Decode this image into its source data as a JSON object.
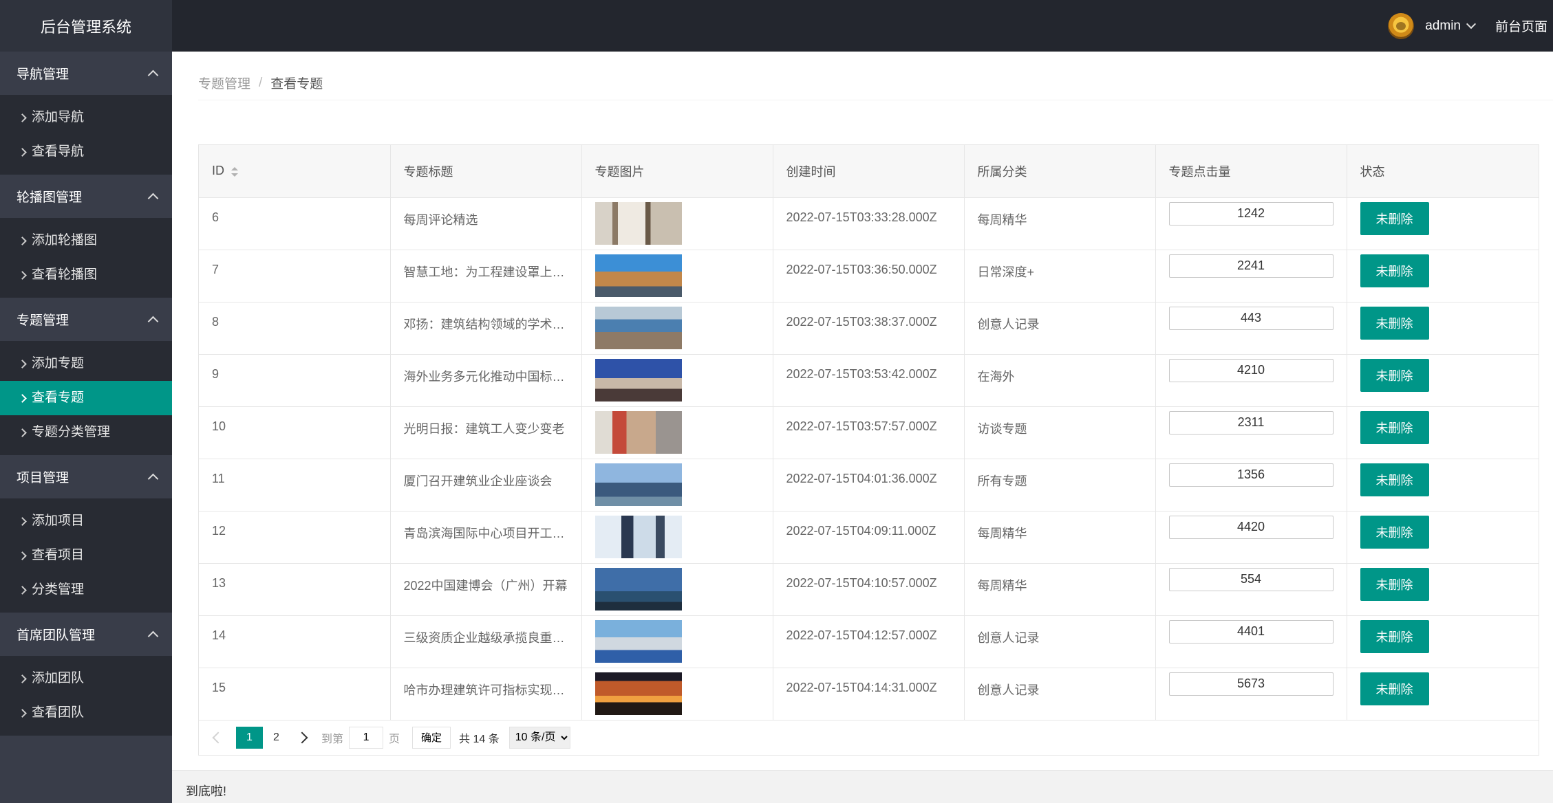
{
  "app": {
    "title": "后台管理系统"
  },
  "header": {
    "user": "admin",
    "front_link": "前台页面"
  },
  "sidebar": {
    "groups": [
      {
        "title": "导航管理",
        "items": [
          "添加导航",
          "查看导航"
        ]
      },
      {
        "title": "轮播图管理",
        "items": [
          "添加轮播图",
          "查看轮播图"
        ]
      },
      {
        "title": "专题管理",
        "items": [
          "添加专题",
          "查看专题",
          "专题分类管理"
        ],
        "active_index": 1
      },
      {
        "title": "项目管理",
        "items": [
          "添加项目",
          "查看项目",
          "分类管理"
        ]
      },
      {
        "title": "首席团队管理",
        "items": [
          "添加团队",
          "查看团队"
        ]
      }
    ]
  },
  "breadcrumb": {
    "parent": "专题管理",
    "separator": "/",
    "current": "查看专题"
  },
  "table": {
    "columns": [
      "ID",
      "专题标题",
      "专题图片",
      "创建时间",
      "所属分类",
      "专题点击量",
      "状态"
    ],
    "rows": [
      {
        "id": "6",
        "title": "每周评论精选",
        "time": "2022-07-15T03:33:28.000Z",
        "category": "每周精华",
        "clicks": "1242",
        "status": "未删除",
        "image": "interior-photo"
      },
      {
        "id": "7",
        "title": "智慧工地：为工程建设罩上…",
        "time": "2022-07-15T03:36:50.000Z",
        "category": "日常深度+",
        "clicks": "2241",
        "status": "未删除",
        "image": "tower-crane-photo"
      },
      {
        "id": "8",
        "title": "邓扬：建筑结构领域的学术“…",
        "time": "2022-07-15T03:38:37.000Z",
        "category": "创意人记录",
        "clicks": "443",
        "status": "未删除",
        "image": "site-workers-photo"
      },
      {
        "id": "9",
        "title": "海外业务多元化推动中国标…",
        "time": "2022-07-15T03:53:42.000Z",
        "category": "在海外",
        "clicks": "4210",
        "status": "未删除",
        "image": "city-street-photo"
      },
      {
        "id": "10",
        "title": "光明日报：建筑工人变少变老",
        "time": "2022-07-15T03:57:57.000Z",
        "category": "访谈专题",
        "clicks": "2311",
        "status": "未删除",
        "image": "worker-helmet-photo"
      },
      {
        "id": "11",
        "title": "厦门召开建筑业企业座谈会",
        "time": "2022-07-15T04:01:36.000Z",
        "category": "所有专题",
        "clicks": "1356",
        "status": "未删除",
        "image": "skyline-photo"
      },
      {
        "id": "12",
        "title": "青岛滨海国际中心项目开工…",
        "time": "2022-07-15T04:09:11.000Z",
        "category": "每周精华",
        "clicks": "4420",
        "status": "未删除",
        "image": "skyscraper-photo"
      },
      {
        "id": "13",
        "title": "2022中国建博会（广州）开幕",
        "time": "2022-07-15T04:10:57.000Z",
        "category": "每周精华",
        "clicks": "554",
        "status": "未删除",
        "image": "tower-photo"
      },
      {
        "id": "14",
        "title": "三级资质企业越级承揽良重…",
        "time": "2022-07-15T04:12:57.000Z",
        "category": "创意人记录",
        "clicks": "4401",
        "status": "未删除",
        "image": "construction-site-photo"
      },
      {
        "id": "15",
        "title": "哈市办理建筑许可指标实现“…",
        "time": "2022-07-15T04:14:31.000Z",
        "category": "创意人记录",
        "clicks": "5673",
        "status": "未删除",
        "image": "sunset-crane-photo"
      }
    ]
  },
  "pagination": {
    "pages": [
      "1",
      "2"
    ],
    "current": "1",
    "goto_label": "到第",
    "goto_value": "1",
    "page_label": "页",
    "confirm": "确定",
    "total": "共 14 条",
    "page_size": "10 条/页"
  },
  "footer": {
    "text": "到底啦!"
  },
  "colors": {
    "accent": "#009688",
    "header_bg": "#23262e",
    "sidebar_bg": "#393d49",
    "submenu_bg": "#282b33"
  }
}
